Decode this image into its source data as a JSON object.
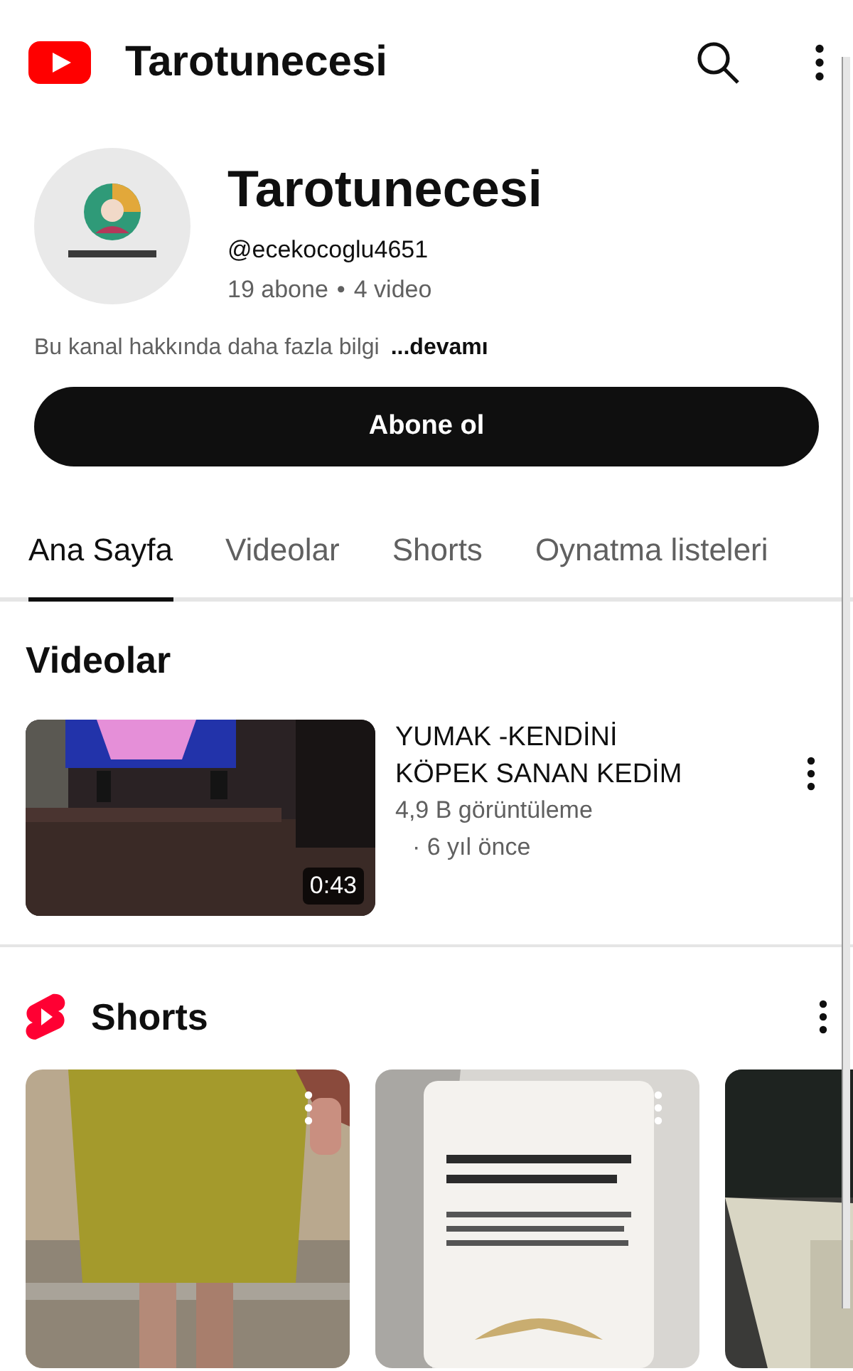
{
  "app_bar": {
    "title": "Tarotunecesi"
  },
  "channel": {
    "name": "Tarotunecesi",
    "handle": "@ecekocoglu4651",
    "subscribers": "19 abone",
    "separator": "•",
    "video_count": "4 video",
    "description": "Bu kanal hakkında daha fazla bilgi",
    "more_link": "...devamı",
    "subscribe_button": "Abone ol"
  },
  "tabs": [
    {
      "label": "Ana Sayfa",
      "selected": true
    },
    {
      "label": "Videolar",
      "selected": false
    },
    {
      "label": "Shorts",
      "selected": false
    },
    {
      "label": "Oynatma listeleri",
      "selected": false
    }
  ],
  "videos_section": {
    "title": "Videolar",
    "videos": [
      {
        "title": "YUMAK -KENDİNİ KÖPEK SANAN KEDİM",
        "duration": "0:43",
        "views": "4,9 B görüntüleme",
        "age": "· 6 yıl önce"
      }
    ]
  },
  "shorts_section": {
    "title": "Shorts",
    "shorts": [
      {
        "kind": "picture",
        "has_menu": true
      },
      {
        "kind": "picture",
        "has_menu": true
      },
      {
        "kind": "picture",
        "has_menu": false
      }
    ]
  }
}
